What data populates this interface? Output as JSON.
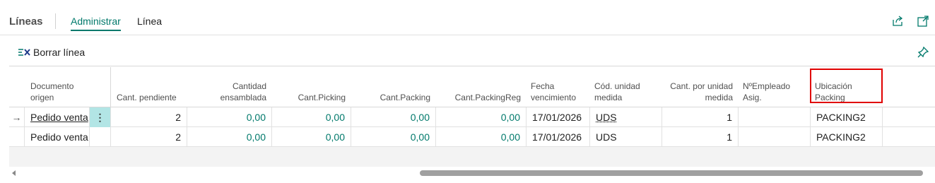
{
  "header": {
    "title": "Líneas",
    "tabs": [
      {
        "label": "Administrar",
        "active": true
      },
      {
        "label": "Línea",
        "active": false
      }
    ],
    "icons": [
      "share-icon",
      "expand-icon"
    ]
  },
  "actions": {
    "delete_line_label": "Borrar línea",
    "icons": [
      "delete-line-icon",
      "pin-icon"
    ]
  },
  "table": {
    "columns": [
      "Documento origen",
      "Cant. pendiente",
      "Cantidad ensamblada",
      "Cant.Picking",
      "Cant.Packing",
      "Cant.PackingReg",
      "Fecha vencimiento",
      "Cód. unidad medida",
      "Cant. por unidad medida",
      "NºEmpleado Asig.",
      "Ubicación Packing"
    ],
    "rows": [
      {
        "selected": true,
        "doc_origin": "Pedido venta",
        "pending": "2",
        "assembled": "0,00",
        "picking": "0,00",
        "packing": "0,00",
        "packing_reg": "0,00",
        "due_date": "17/01/2026",
        "uom": "UDS",
        "qty_per_uom": "1",
        "employee": "",
        "location": "PACKING2"
      },
      {
        "selected": false,
        "doc_origin": "Pedido venta",
        "pending": "2",
        "assembled": "0,00",
        "picking": "0,00",
        "packing": "0,00",
        "packing_reg": "0,00",
        "due_date": "17/01/2026",
        "uom": "UDS",
        "qty_per_uom": "1",
        "employee": "",
        "location": "PACKING2"
      }
    ]
  },
  "colors": {
    "accent": "#00796b",
    "highlight": "#e00000",
    "selected_cell": "#b2e5e5"
  }
}
